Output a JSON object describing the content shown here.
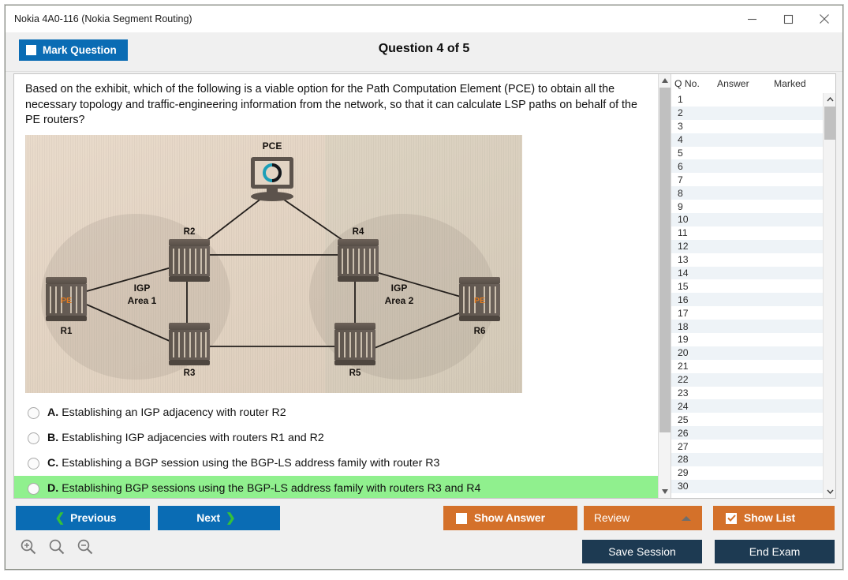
{
  "window": {
    "title": "Nokia 4A0-116 (Nokia Segment Routing)",
    "minimize_label": "—",
    "maximize_label": "☐",
    "close_label": "✕"
  },
  "header": {
    "mark_question_label": "Mark Question",
    "question_counter": "Question 4 of 5"
  },
  "question": {
    "text": "Based on the exhibit, which of the following is a viable option for the Path Computation Element (PCE) to obtain all the necessary topology and traffic-engineering information from the network, so that it can calculate LSP paths on behalf of the PE routers?",
    "options": [
      {
        "letter": "A.",
        "text": "Establishing an IGP adjacency with router R2",
        "highlighted": false,
        "selected": false
      },
      {
        "letter": "B.",
        "text": "Establishing IGP adjacencies with routers R1 and R2",
        "highlighted": false,
        "selected": false
      },
      {
        "letter": "C.",
        "text": "Establishing a BGP session using the BGP-LS address family with router R3",
        "highlighted": false,
        "selected": false
      },
      {
        "letter": "D.",
        "text": "Establishing BGP sessions using the BGP-LS address family with routers R3 and R4",
        "highlighted": true,
        "selected": false
      }
    ]
  },
  "exhibit": {
    "alt": "network topology diagram photo",
    "background_color": "#e4d6c6",
    "nodes": [
      {
        "id": "PCE",
        "label": "PCE",
        "type": "computer"
      },
      {
        "id": "R1",
        "label": "R1",
        "type": "pe-router",
        "badge": "PE"
      },
      {
        "id": "R2",
        "label": "R2",
        "type": "router"
      },
      {
        "id": "R3",
        "label": "R3",
        "type": "router"
      },
      {
        "id": "R4",
        "label": "R4",
        "type": "router"
      },
      {
        "id": "R5",
        "label": "R5",
        "type": "router"
      },
      {
        "id": "R6",
        "label": "R6",
        "type": "pe-router",
        "badge": "PE"
      }
    ],
    "areas": [
      {
        "line1": "IGP",
        "line2": "Area 1"
      },
      {
        "line1": "IGP",
        "line2": "Area 2"
      }
    ],
    "links": [
      [
        "PCE",
        "R2"
      ],
      [
        "PCE",
        "R4"
      ],
      [
        "R1",
        "R2"
      ],
      [
        "R1",
        "R3"
      ],
      [
        "R2",
        "R3"
      ],
      [
        "R2",
        "R4"
      ],
      [
        "R3",
        "R5"
      ],
      [
        "R4",
        "R5"
      ],
      [
        "R4",
        "R6"
      ],
      [
        "R5",
        "R6"
      ]
    ]
  },
  "list": {
    "columns": [
      "Q No.",
      "Answer",
      "Marked"
    ],
    "rows": [
      {
        "qno": "1",
        "answer": "",
        "marked": ""
      },
      {
        "qno": "2",
        "answer": "",
        "marked": ""
      },
      {
        "qno": "3",
        "answer": "",
        "marked": ""
      },
      {
        "qno": "4",
        "answer": "",
        "marked": ""
      },
      {
        "qno": "5",
        "answer": "",
        "marked": ""
      },
      {
        "qno": "6",
        "answer": "",
        "marked": ""
      },
      {
        "qno": "7",
        "answer": "",
        "marked": ""
      },
      {
        "qno": "8",
        "answer": "",
        "marked": ""
      },
      {
        "qno": "9",
        "answer": "",
        "marked": ""
      },
      {
        "qno": "10",
        "answer": "",
        "marked": ""
      },
      {
        "qno": "11",
        "answer": "",
        "marked": ""
      },
      {
        "qno": "12",
        "answer": "",
        "marked": ""
      },
      {
        "qno": "13",
        "answer": "",
        "marked": ""
      },
      {
        "qno": "14",
        "answer": "",
        "marked": ""
      },
      {
        "qno": "15",
        "answer": "",
        "marked": ""
      },
      {
        "qno": "16",
        "answer": "",
        "marked": ""
      },
      {
        "qno": "17",
        "answer": "",
        "marked": ""
      },
      {
        "qno": "18",
        "answer": "",
        "marked": ""
      },
      {
        "qno": "19",
        "answer": "",
        "marked": ""
      },
      {
        "qno": "20",
        "answer": "",
        "marked": ""
      },
      {
        "qno": "21",
        "answer": "",
        "marked": ""
      },
      {
        "qno": "22",
        "answer": "",
        "marked": ""
      },
      {
        "qno": "23",
        "answer": "",
        "marked": ""
      },
      {
        "qno": "24",
        "answer": "",
        "marked": ""
      },
      {
        "qno": "25",
        "answer": "",
        "marked": ""
      },
      {
        "qno": "26",
        "answer": "",
        "marked": ""
      },
      {
        "qno": "27",
        "answer": "",
        "marked": ""
      },
      {
        "qno": "28",
        "answer": "",
        "marked": ""
      },
      {
        "qno": "29",
        "answer": "",
        "marked": ""
      },
      {
        "qno": "30",
        "answer": "",
        "marked": ""
      }
    ]
  },
  "footer": {
    "previous_label": "Previous",
    "next_label": "Next",
    "show_answer_label": "Show Answer",
    "show_answer_checked": false,
    "review_label": "Review",
    "show_list_label": "Show List",
    "show_list_checked": true,
    "save_session_label": "Save Session",
    "end_exam_label": "End Exam",
    "chevron_left": "❮",
    "chevron_right": "❯"
  },
  "zoom_tools": [
    {
      "name": "zoom-in-icon"
    },
    {
      "name": "zoom-reset-icon"
    },
    {
      "name": "zoom-out-icon"
    }
  ],
  "colors": {
    "primary_blue": "#0a6cb4",
    "orange": "#d4712a",
    "navy": "#1d3a52",
    "correct_green": "#90f08e",
    "chevron_green": "#35c13a"
  }
}
